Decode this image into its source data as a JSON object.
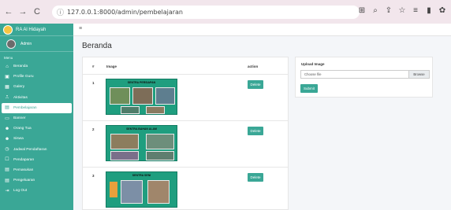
{
  "browser": {
    "url": "127.0.0.1:8000/admin/pembelajaran"
  },
  "sidebar": {
    "brand": "RA Al Hidayah",
    "user": "Admin",
    "menu_header": "Menu",
    "items": [
      {
        "label": "Beranda",
        "icon": "home-icon"
      },
      {
        "label": "Profile Guru",
        "icon": "id-card-icon"
      },
      {
        "label": "Galery",
        "icon": "images-icon"
      },
      {
        "label": "Aktivitas",
        "icon": "chart-icon"
      },
      {
        "label": "Pembelajaran",
        "icon": "book-icon",
        "active": true
      },
      {
        "label": "Banner",
        "icon": "banner-icon"
      },
      {
        "label": "Orang Tua",
        "icon": "users-icon"
      },
      {
        "label": "Siswa",
        "icon": "users-icon"
      },
      {
        "label": "Jadwal Pendaftaran",
        "icon": "clock-icon"
      },
      {
        "label": "Pendaparan",
        "icon": "form-icon"
      },
      {
        "label": "Pemasukan",
        "icon": "table-icon"
      },
      {
        "label": "Pengeluaran",
        "icon": "table-icon"
      },
      {
        "label": "Log Out",
        "icon": "logout-icon"
      }
    ]
  },
  "page": {
    "title": "Beranda"
  },
  "table": {
    "headers": {
      "num": "#",
      "image": "Image",
      "action": "action"
    },
    "rows": [
      {
        "num": "1",
        "thumb_title": "SENTRA PERSIAPAN",
        "action": "Delete"
      },
      {
        "num": "2",
        "thumb_title": "SENTRA BAHAN ALAM",
        "action": "Delete"
      },
      {
        "num": "3",
        "thumb_title": "SENTRA SENI",
        "action": "Delete"
      }
    ]
  },
  "upload": {
    "label": "Upload Image",
    "placeholder": "Choose file",
    "browse": "Browse",
    "submit": "Submit"
  },
  "colors": {
    "accent": "#3aa796",
    "thumb_bg": "#1f9e7f"
  }
}
